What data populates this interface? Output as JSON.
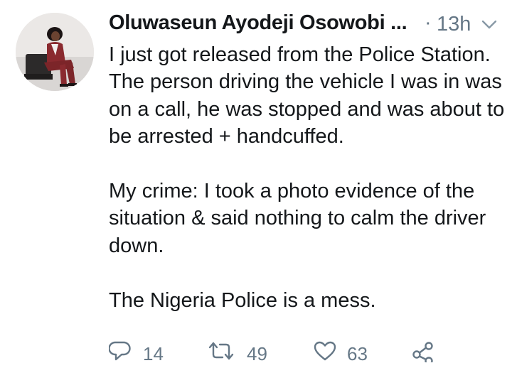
{
  "tweet": {
    "author_name": "Oluwaseun Ayodeji Osowobi ...",
    "separator": "·",
    "timestamp": "13h",
    "paragraphs": [
      "I just got released from the Police Station. The person driving the vehicle I was in was on a call, he was stopped and was about to be arrested + handcuffed.",
      "My crime: I took a photo evidence of the situation & said nothing to calm the driver down.",
      "The Nigeria Police is a mess."
    ],
    "actions": {
      "reply_count": "14",
      "retweet_count": "49",
      "like_count": "63"
    }
  },
  "icons": {
    "avatar": "profile-photo",
    "caret": "chevron-down-icon",
    "reply": "reply-icon",
    "retweet": "retweet-icon",
    "like": "heart-icon",
    "share": "share-icon"
  },
  "colors": {
    "text_primary": "#14171a",
    "text_secondary": "#657786",
    "background": "#ffffff"
  }
}
